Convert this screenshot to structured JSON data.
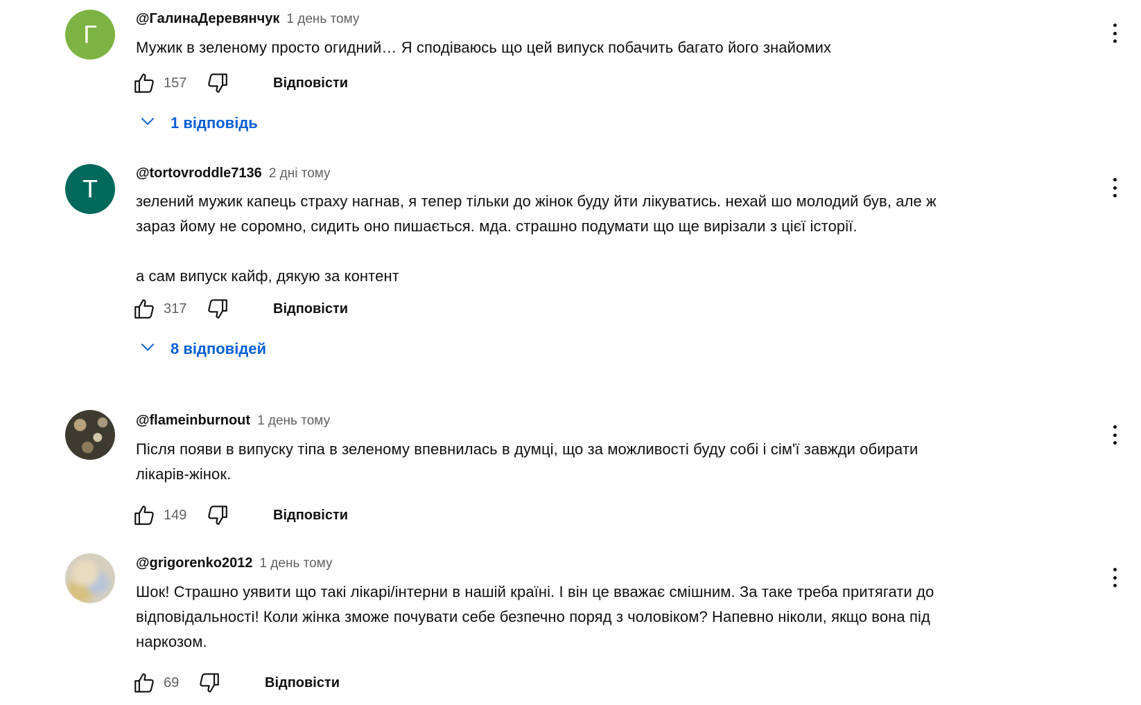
{
  "comments": [
    {
      "avatar_letter": "Г",
      "avatar_color": "#7cb342",
      "author": "@ГалинаДеревянчук",
      "time": "1 день тому",
      "lines": [
        "Мужик в зеленому просто огидний… Я сподіваюсь що цей випуск побачить багато його знайомих"
      ],
      "likes": "157",
      "reply_label": "Відповісти",
      "replies_label": "1 відповідь"
    },
    {
      "avatar_letter": "T",
      "avatar_color": "#00695c",
      "author": "@tortovroddle7136",
      "time": "2 дні тому",
      "lines": [
        "зелений мужик капець страху нагнав, я тепер тільки до жінок буду йти лікуватись. нехай шо молодий був, але ж",
        "зараз йому не соромно, сидить оно пишається. мда. страшно подумати що ще вирізали з цієї історії.",
        "",
        "а сам випуск кайф, дякую за контент"
      ],
      "likes": "317",
      "reply_label": "Відповісти",
      "replies_label": "8 відповідей"
    },
    {
      "author": "@flameinburnout",
      "time": "1 день тому",
      "lines": [
        "Після появи в випуску тіпа в зеленому впевнилась в думці, що за можливості буду собі і сім'ї завжди обирати",
        "лікарів-жінок."
      ],
      "likes": "149",
      "reply_label": "Відповісти"
    },
    {
      "author": "@grigorenko2012",
      "time": "1 день тому",
      "lines": [
        "Шок! Страшно уявити що такі лікарі/інтерни в нашій країні. І він це вважає смішним. За таке треба притягати до",
        "відповідальності! Коли жінка зможе почувати себе безпечно поряд з чоловіком? Напевно ніколи, якщо вона під",
        "наркозом."
      ],
      "likes": "69",
      "reply_label": "Відповісти"
    }
  ],
  "icons": {
    "like": "thumbs-up-icon",
    "dislike": "thumbs-down-icon",
    "more": "more-vert-icon",
    "expand": "chevron-down-icon"
  },
  "colors": {
    "link_blue": "#065fd4",
    "secondary_text": "#606060"
  }
}
